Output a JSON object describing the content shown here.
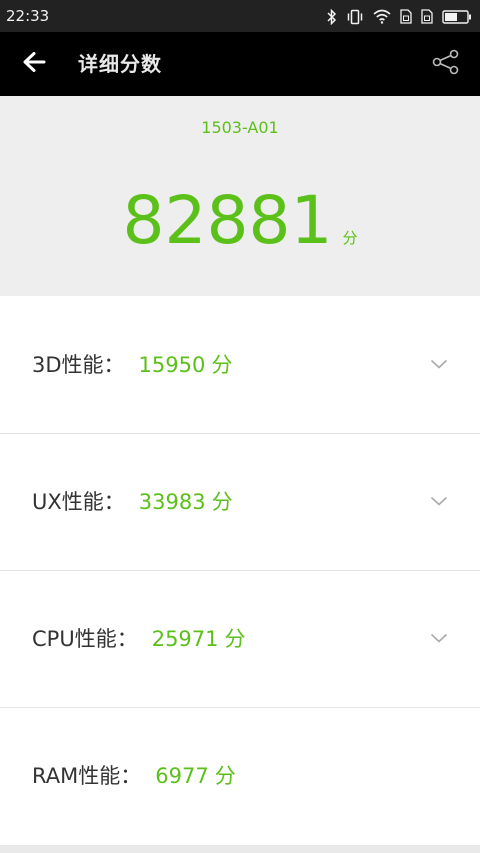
{
  "status_bar": {
    "time": "22:33"
  },
  "app_bar": {
    "title": "详细分数"
  },
  "device": {
    "name": "1503-A01"
  },
  "total": {
    "score": "82881",
    "unit": "分"
  },
  "rows": [
    {
      "label": "3D性能：",
      "value": "15950",
      "unit": "分",
      "expandable": true
    },
    {
      "label": "UX性能：",
      "value": "33983",
      "unit": "分",
      "expandable": true
    },
    {
      "label": "CPU性能：",
      "value": "25971",
      "unit": "分",
      "expandable": true
    },
    {
      "label": "RAM性能：",
      "value": "6977",
      "unit": "分",
      "expandable": false
    }
  ],
  "colors": {
    "accent": "#5cc01a",
    "app_bar": "#000000",
    "status_bar": "#222222",
    "header_bg": "#eeeeee"
  }
}
